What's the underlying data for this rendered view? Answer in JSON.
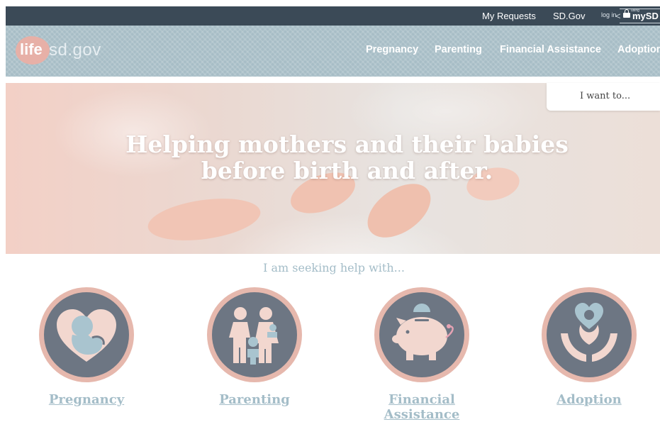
{
  "topbar": {
    "my_requests": "My Requests",
    "sd_gov": "SD.Gov",
    "login": "log in",
    "using": "using",
    "mysd": "mySD"
  },
  "header": {
    "logo_life": "life",
    "logo_rest": "sd.gov",
    "nav": [
      "Pregnancy",
      "Parenting",
      "Financial Assistance",
      "Adoption"
    ]
  },
  "hero": {
    "title_line1": "Helping mothers and their babies",
    "title_line2": "before birth and after.",
    "i_want": "I want to..."
  },
  "seeking": "I am seeking help with...",
  "categories": [
    {
      "label": "Pregnancy",
      "icon": "fetus-heart-icon"
    },
    {
      "label": "Parenting",
      "icon": "family-icon"
    },
    {
      "label_line1": "Financial",
      "label_line2": "Assistance",
      "icon": "piggy-bank-icon"
    },
    {
      "label": "Adoption",
      "icon": "hands-child-icon"
    }
  ],
  "colors": {
    "topbar": "#3b4a57",
    "header": "#a7bdc6",
    "ring": "#e6b8ad",
    "icon_bg": "#6d7683",
    "accent_blue": "#a4bdc8"
  }
}
